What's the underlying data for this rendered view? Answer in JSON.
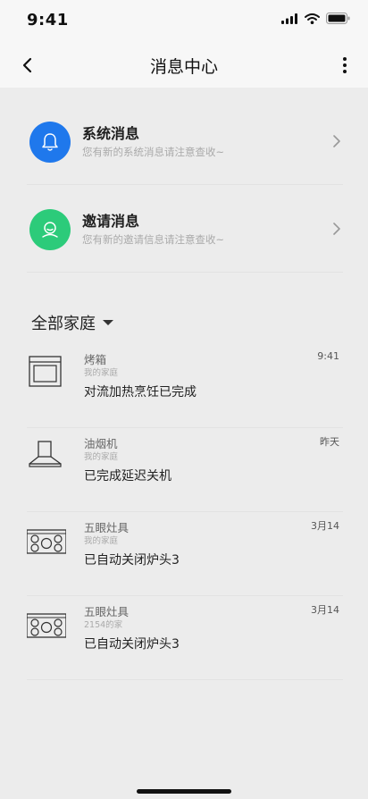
{
  "status_bar": {
    "time": "9:41"
  },
  "nav": {
    "title": "消息中心"
  },
  "messages": [
    {
      "title": "系统消息",
      "subtitle": "您有新的系统消息请注意查收~",
      "icon": "bell-icon",
      "color": "#1f78ec"
    },
    {
      "title": "邀请消息",
      "subtitle": "您有新的邀请信息请注意查收~",
      "icon": "user-icon",
      "color": "#2ccb7a"
    }
  ],
  "family_filter": {
    "label": "全部家庭"
  },
  "devices": [
    {
      "name": "烤箱",
      "home": "我的家庭",
      "message": "对流加热烹饪已完成",
      "time": "9:41",
      "icon": "oven-icon"
    },
    {
      "name": "油烟机",
      "home": "我的家庭",
      "message": "已完成延迟关机",
      "time": "昨天",
      "icon": "range-hood-icon"
    },
    {
      "name": "五眼灶具",
      "home": "我的家庭",
      "message": "已自动关闭炉头3",
      "time": "3月14",
      "icon": "stove-icon"
    },
    {
      "name": "五眼灶具",
      "home": "2154的家",
      "message": "已自动关闭炉头3",
      "time": "3月14",
      "icon": "stove-icon"
    }
  ]
}
